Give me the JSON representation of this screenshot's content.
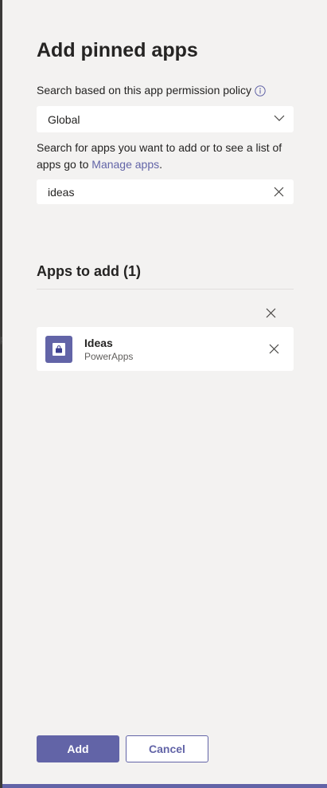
{
  "dialog": {
    "title": "Add pinned apps",
    "policy_label": "Search based on this app permission policy",
    "policy_value": "Global",
    "help_text_prefix": "Search for apps you want to add or to see a list of apps go to ",
    "manage_apps_link": "Manage apps",
    "help_text_suffix": ".",
    "search_value": "ideas",
    "apps_section_title": "Apps to add (1)",
    "apps": [
      {
        "name": "Ideas",
        "publisher": "PowerApps"
      }
    ],
    "add_button": "Add",
    "cancel_button": "Cancel"
  },
  "backdrop": {
    "edge_glyph": "p"
  },
  "icons": {
    "info": "info-circle-icon",
    "chevron": "chevron-down-icon",
    "clear": "close-icon",
    "app": "ideas-app-icon"
  },
  "colors": {
    "accent": "#6264a7",
    "panel_background": "#f3f2f1",
    "field_background": "#ffffff",
    "text_primary": "#252423",
    "text_secondary": "#605e5c"
  }
}
